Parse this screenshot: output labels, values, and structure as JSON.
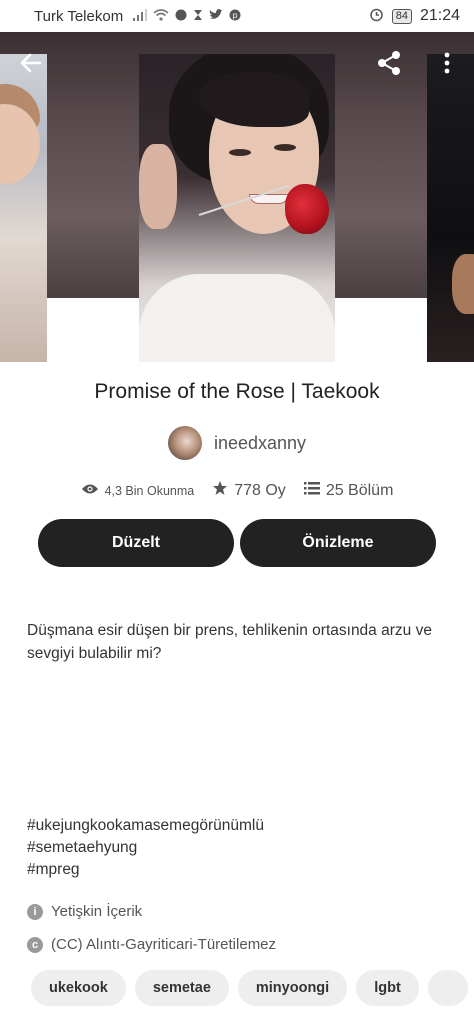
{
  "status_bar": {
    "carrier": "Turk Telekom",
    "battery": "84",
    "time": "21:24"
  },
  "story": {
    "title": "Promise of the Rose | Taekook",
    "author": "ineedxanny",
    "reads": "4,3 Bin Okunma",
    "votes": "778 Oy",
    "parts": "25 Bölüm",
    "description": "Düşmana esir düşen bir prens, tehlikenin ortasında arzu ve sevgiyi bulabilir mi?",
    "hashtags": [
      "#ukejungkookamasemegörünümlü",
      "#semetaehyung",
      "#mpreg"
    ],
    "rating": "Yetişkin İçerik",
    "license": "(CC) Alıntı-Gayriticari-Türetilemez"
  },
  "actions": {
    "edit": "Düzelt",
    "preview": "Önizleme"
  },
  "tag_chips": [
    "ukekook",
    "semetae",
    "minyoongi",
    "lgbt"
  ],
  "icons": {
    "back": "back-arrow-icon",
    "share": "share-icon",
    "more": "more-vertical-icon",
    "reads": "eye-icon",
    "votes": "star-icon",
    "parts": "list-icon",
    "rating": "info-icon",
    "license": "copyright-icon"
  },
  "colors": {
    "primary_button": "#222222",
    "chip_bg": "#eeeeee",
    "hero_bg": "#5a4b4e"
  }
}
